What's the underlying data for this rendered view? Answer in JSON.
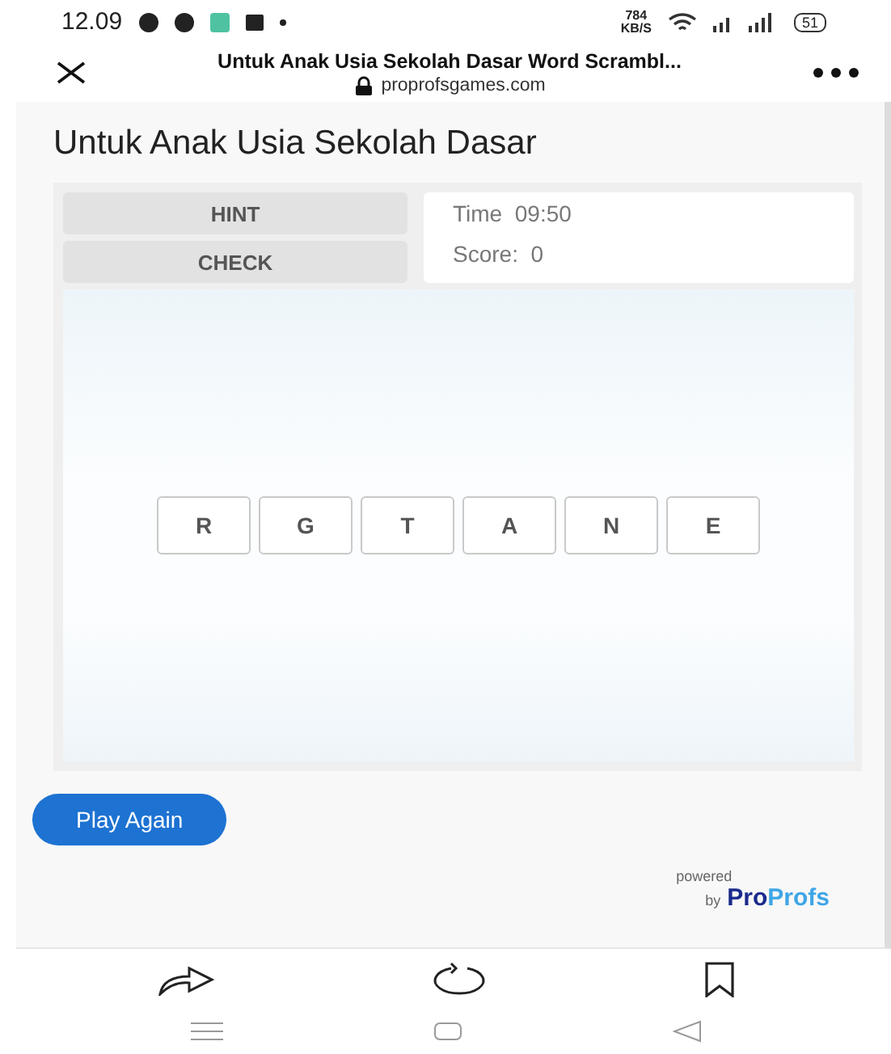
{
  "status_bar": {
    "time": "12.09",
    "speed_value": "784",
    "speed_unit": "KB/S",
    "battery": "51"
  },
  "browser": {
    "page_title": "Untuk Anak Usia Sekolah Dasar Word Scrambl...",
    "url": "proprofsgames.com"
  },
  "page": {
    "title": "Untuk Anak Usia Sekolah Dasar"
  },
  "game": {
    "buttons": [
      "HINT",
      "CHECK"
    ],
    "time_label": "Time",
    "time_value": "09:50",
    "score_label": "Score:",
    "score_value": "0",
    "tiles": [
      "R",
      "G",
      "T",
      "A",
      "N",
      "E"
    ]
  },
  "play_again": "Play Again",
  "powered": {
    "line1": "powered",
    "line2": "by",
    "brand_dark": "Pro",
    "brand_light": "Profs"
  }
}
